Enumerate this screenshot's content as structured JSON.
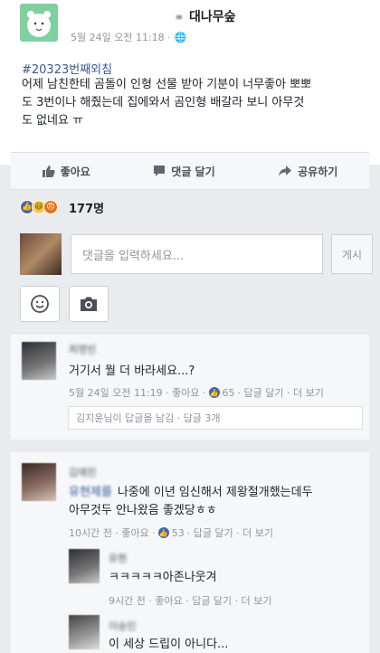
{
  "post": {
    "page_name": "대나무숲",
    "timestamp": "5월 24일 오전 11:18 ·",
    "globe_icon": "globe-icon",
    "hashtag": "#20323번째외침",
    "body_lines": [
      "어제 남친한테 곰돌이 인형 선물 받아 기분이 너무좋아 뽀뽀",
      "도 3번이나 해줬는데 집에와서 곰인형 배갈라 보니 아무것",
      "도 없네요 ㅠ"
    ]
  },
  "actions": {
    "like": "좋아요",
    "comment": "댓글 달기",
    "share": "공유하기"
  },
  "reactions": {
    "icons": [
      "like-reaction-icon",
      "haha-reaction-icon",
      "angry-reaction-icon"
    ],
    "count": "177명"
  },
  "composer": {
    "placeholder": "댓글을 입력하세요...",
    "post_label": "게시"
  },
  "comments": [
    {
      "name": "최명빈",
      "text": "거기서 뭘 더 바라세요...?",
      "time": "5월 24일 오전 11:19 · 좋아요 ·",
      "likes": "65",
      "reply": "· 답글 달기 · 더 보기",
      "replies_note": "김지윤님이 답글을 남김 · 답글 3개"
    },
    {
      "name": "김예린",
      "mention": "유현제를",
      "text_line1": "나중에 이년 임신해서 제왕절개했는데두",
      "text_line2": "아무것두 안나왔음 좋겠당ㅎㅎ",
      "time": "10시간 전 · 좋아요 ·",
      "likes": "53",
      "reply": "· 답글 달기 · 더 보기"
    }
  ],
  "replies": [
    {
      "name": "유현",
      "text": "ㅋㅋㅋㅋㅋ아존나웃겨",
      "meta": "9시간 전 · 좋아요 · 답글 달기 · 더 보기"
    },
    {
      "name": "이승민",
      "text": "이 세상 드립이 아니다..."
    }
  ]
}
